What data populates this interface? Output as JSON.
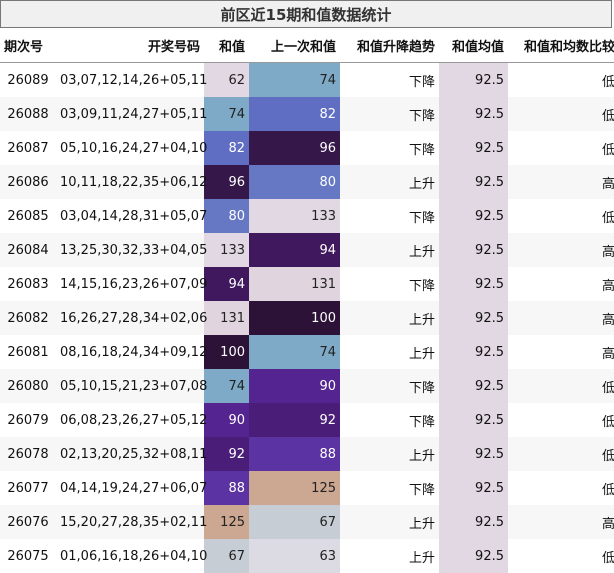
{
  "title": "前区近15期和值数据统计",
  "headers": {
    "period": "期次号",
    "draw": "开奖号码",
    "sum": "和值",
    "prev_sum": "上一次和值",
    "trend": "和值升降趋势",
    "avg": "和值均值",
    "compare": "和值和均数比较"
  },
  "rows": [
    {
      "period": "26089",
      "draw": "03,07,12,14,26+05,11",
      "sum": "62",
      "sum_color": "#e2d8e3",
      "prev": "74",
      "prev_color": "#7eaac8",
      "trend": "下降",
      "avg": "92.5",
      "cmp": "低"
    },
    {
      "period": "26088",
      "draw": "03,09,11,24,27+05,11",
      "sum": "74",
      "sum_color": "#7eaac8",
      "prev": "82",
      "prev_color": "#5f6ec2",
      "trend": "下降",
      "avg": "92.5",
      "cmp": "低"
    },
    {
      "period": "26087",
      "draw": "05,10,16,24,27+04,10",
      "sum": "82",
      "sum_color": "#5f6ec2",
      "prev": "96",
      "prev_color": "#35174a",
      "trend": "下降",
      "avg": "92.5",
      "cmp": "低"
    },
    {
      "period": "26086",
      "draw": "10,11,18,22,35+06,12",
      "sum": "96",
      "sum_color": "#35174a",
      "prev": "80",
      "prev_color": "#6677c4",
      "trend": "上升",
      "avg": "92.5",
      "cmp": "高"
    },
    {
      "period": "26085",
      "draw": "03,04,14,28,31+05,07",
      "sum": "80",
      "sum_color": "#6677c4",
      "prev": "133",
      "prev_color": "#e2d8e3",
      "trend": "下降",
      "avg": "92.5",
      "cmp": "低"
    },
    {
      "period": "26084",
      "draw": "13,25,30,32,33+04,05",
      "sum": "133",
      "sum_color": "#e2d8e3",
      "prev": "94",
      "prev_color": "#40185e",
      "trend": "上升",
      "avg": "92.5",
      "cmp": "高"
    },
    {
      "period": "26083",
      "draw": "14,15,16,23,26+07,09",
      "sum": "94",
      "sum_color": "#40185e",
      "prev": "131",
      "prev_color": "#e0d5de",
      "trend": "下降",
      "avg": "92.5",
      "cmp": "高"
    },
    {
      "period": "26082",
      "draw": "16,26,27,28,34+02,06",
      "sum": "131",
      "sum_color": "#e0d5de",
      "prev": "100",
      "prev_color": "#2c1236",
      "trend": "上升",
      "avg": "92.5",
      "cmp": "高"
    },
    {
      "period": "26081",
      "draw": "08,16,18,24,34+09,12",
      "sum": "100",
      "sum_color": "#2c1236",
      "prev": "74",
      "prev_color": "#7eaac8",
      "trend": "上升",
      "avg": "92.5",
      "cmp": "高"
    },
    {
      "period": "26080",
      "draw": "05,10,15,21,23+07,08",
      "sum": "74",
      "sum_color": "#7eaac8",
      "prev": "90",
      "prev_color": "#542490",
      "trend": "下降",
      "avg": "92.5",
      "cmp": "低"
    },
    {
      "period": "26079",
      "draw": "06,08,23,26,27+05,12",
      "sum": "90",
      "sum_color": "#542490",
      "prev": "92",
      "prev_color": "#4a1e78",
      "trend": "下降",
      "avg": "92.5",
      "cmp": "低"
    },
    {
      "period": "26078",
      "draw": "02,13,20,25,32+08,11",
      "sum": "92",
      "sum_color": "#4a1e78",
      "prev": "88",
      "prev_color": "#5b33a2",
      "trend": "上升",
      "avg": "92.5",
      "cmp": "低"
    },
    {
      "period": "26077",
      "draw": "04,14,19,24,27+06,07",
      "sum": "88",
      "sum_color": "#5b33a2",
      "prev": "125",
      "prev_color": "#cca791",
      "trend": "下降",
      "avg": "92.5",
      "cmp": "低"
    },
    {
      "period": "26076",
      "draw": "15,20,27,28,35+02,11",
      "sum": "125",
      "sum_color": "#cca791",
      "prev": "67",
      "prev_color": "#c6cdd4",
      "trend": "上升",
      "avg": "92.5",
      "cmp": "高"
    },
    {
      "period": "26075",
      "draw": "01,06,16,18,26+04,10",
      "sum": "67",
      "sum_color": "#c6cdd4",
      "prev": "63",
      "prev_color": "#dcdae2",
      "trend": "上升",
      "avg": "92.5",
      "cmp": "低"
    }
  ]
}
